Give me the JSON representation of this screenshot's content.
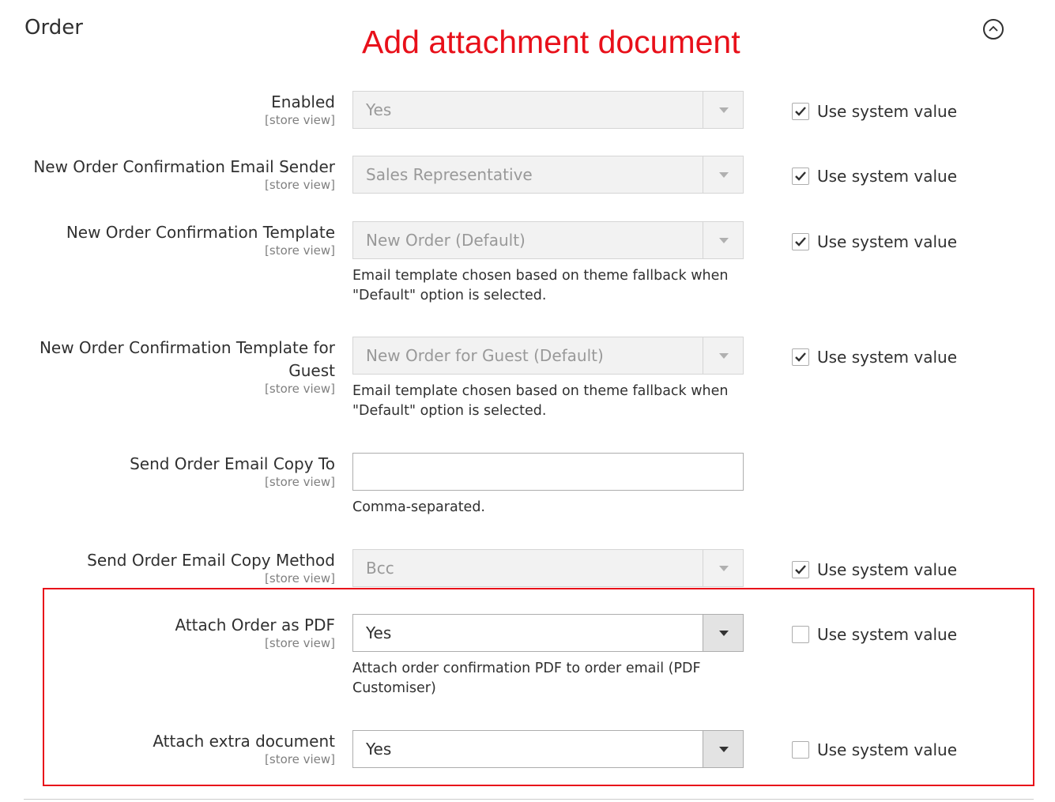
{
  "section": {
    "title": "Order",
    "collapse_icon": "chevron-up-circle-icon"
  },
  "annotation": {
    "text": "Add attachment document",
    "color": "#e8101a"
  },
  "fields": [
    {
      "label": "Enabled",
      "scope": "[store view]",
      "value": "Yes",
      "disabled": true,
      "use_system": true,
      "use_system_label": "Use system value"
    },
    {
      "label": "New Order Confirmation Email Sender",
      "scope": "[store view]",
      "value": "Sales Representative",
      "disabled": true,
      "use_system": true,
      "use_system_label": "Use system value"
    },
    {
      "label": "New Order Confirmation Template",
      "scope": "[store view]",
      "value": "New Order (Default)",
      "disabled": true,
      "note": "Email template chosen based on theme fallback when \"Default\" option is selected.",
      "use_system": true,
      "use_system_label": "Use system value"
    },
    {
      "label": "New Order Confirmation Template for Guest",
      "scope": "[store view]",
      "value": "New Order for Guest (Default)",
      "disabled": true,
      "note": "Email template chosen based on theme fallback when \"Default\" option is selected.",
      "use_system": true,
      "use_system_label": "Use system value"
    },
    {
      "label": "Send Order Email Copy To",
      "scope": "[store view]",
      "value": "",
      "note": "Comma-separated."
    },
    {
      "label": "Send Order Email Copy Method",
      "scope": "[store view]",
      "value": "Bcc",
      "disabled": true,
      "use_system": true,
      "use_system_label": "Use system value"
    },
    {
      "label": "Attach Order as PDF",
      "scope": "[store view]",
      "value": "Yes",
      "disabled": false,
      "note": "Attach order confirmation PDF to order email (PDF Customiser)",
      "use_system": false,
      "use_system_label": "Use system value"
    },
    {
      "label": "Attach extra document",
      "scope": "[store view]",
      "value": "Yes",
      "disabled": false,
      "use_system": false,
      "use_system_label": "Use system value"
    }
  ]
}
